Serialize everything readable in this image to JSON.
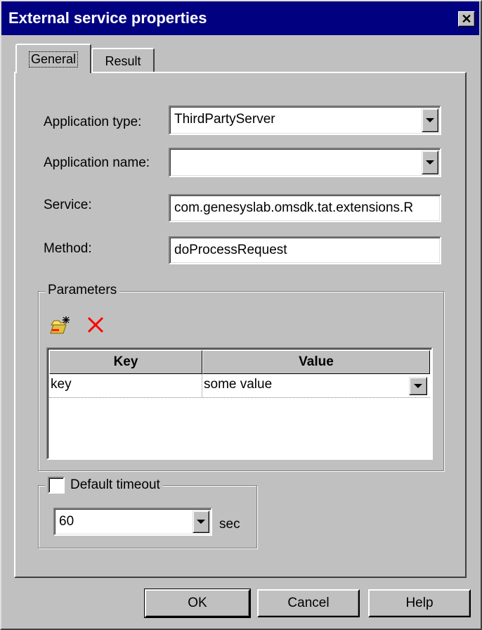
{
  "window": {
    "title": "External service properties",
    "close_glyph": "✕"
  },
  "tabs": [
    {
      "label": "General",
      "selected": true
    },
    {
      "label": "Result",
      "selected": false
    }
  ],
  "form": {
    "application_type": {
      "label": "Application type:",
      "value": "ThirdPartyServer"
    },
    "application_name": {
      "label": "Application name:",
      "value": ""
    },
    "service": {
      "label": "Service:",
      "value": "com.genesyslab.omsdk.tat.extensions.R"
    },
    "method": {
      "label": "Method:",
      "value": "doProcessRequest"
    }
  },
  "parameters": {
    "title": "Parameters",
    "toolbar": {
      "add_icon": "add-parameter-icon",
      "delete_icon": "delete-icon",
      "delete_color": "#ff0000"
    },
    "columns": [
      "Key",
      "Value"
    ],
    "rows": [
      {
        "key": "key",
        "value": "some value"
      }
    ]
  },
  "timeout": {
    "label": "Default timeout",
    "checked": false,
    "value": "60",
    "unit": "sec"
  },
  "buttons": {
    "ok": "OK",
    "cancel": "Cancel",
    "help": "Help"
  },
  "colors": {
    "titlebar": "#000080",
    "face": "#c0c0c0"
  }
}
